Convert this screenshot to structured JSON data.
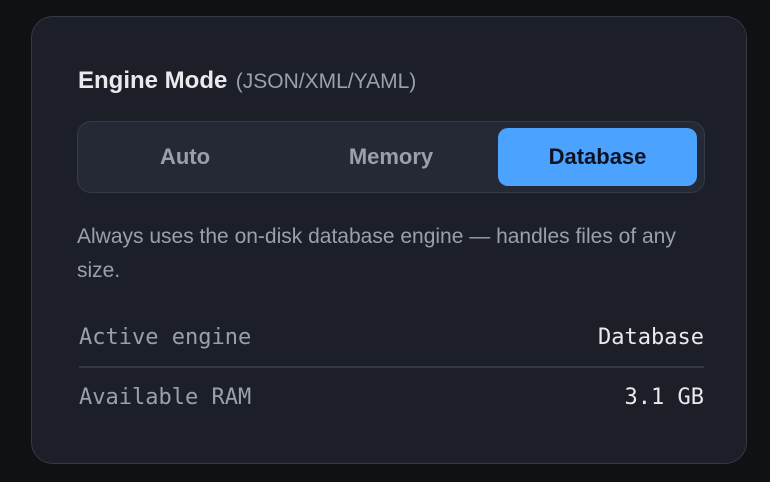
{
  "engine_mode": {
    "title": "Engine Mode",
    "subtitle": "(JSON/XML/YAML)",
    "options": [
      {
        "label": "Auto",
        "selected": false
      },
      {
        "label": "Memory",
        "selected": false
      },
      {
        "label": "Database",
        "selected": true
      }
    ],
    "description": "Always uses the on-disk database engine — handles files of any size."
  },
  "info": {
    "active_engine": {
      "label": "Active engine",
      "value": "Database"
    },
    "available_ram": {
      "label": "Available RAM",
      "value": "3.1 GB"
    }
  },
  "colors": {
    "accent": "#4ca2ff",
    "card_background": "#1c1f28",
    "page_background": "#0f1115"
  }
}
